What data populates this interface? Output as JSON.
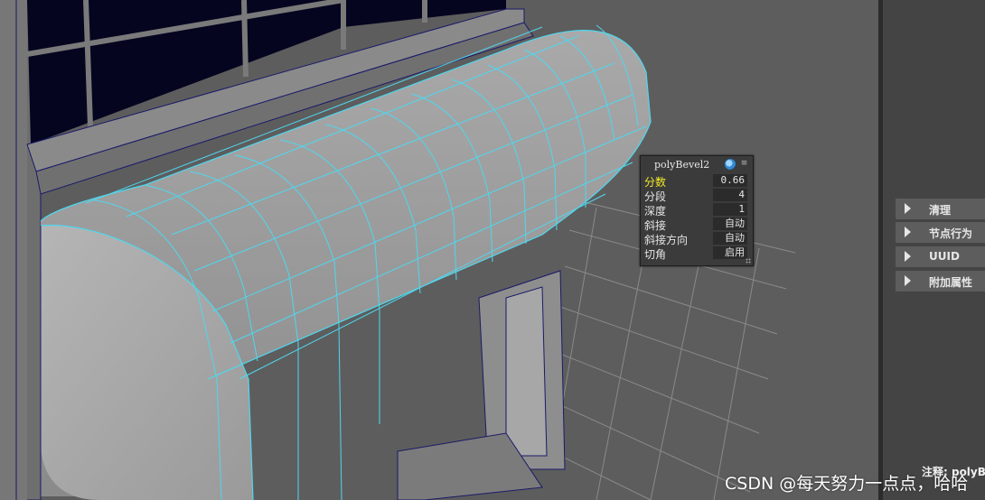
{
  "inview_editor": {
    "title": "polyBevel2",
    "attributes": [
      {
        "label": "分数",
        "value": "0.66",
        "highlighted": true
      },
      {
        "label": "分段",
        "value": "4"
      },
      {
        "label": "深度",
        "value": "1"
      },
      {
        "label": "斜接",
        "value": "自动"
      },
      {
        "label": "斜接方向",
        "value": "自动"
      },
      {
        "label": "切角",
        "value": "启用"
      }
    ],
    "highlight_color": "#f2e92a"
  },
  "attribute_panel": {
    "sections": [
      {
        "label": "清理",
        "icon": "expand-triangle-icon"
      },
      {
        "label": "节点行为",
        "icon": "expand-triangle-icon"
      },
      {
        "label": "UUID",
        "icon": "expand-triangle-icon"
      },
      {
        "label": "附加属性",
        "icon": "expand-triangle-icon"
      }
    ],
    "notes_label": "注释: polyBeve"
  },
  "viewport": {
    "background_color": "#5d5d5d",
    "wireframe_color": "#4fd7ee"
  },
  "watermark": "CSDN @每天努力一点点，哈哈"
}
